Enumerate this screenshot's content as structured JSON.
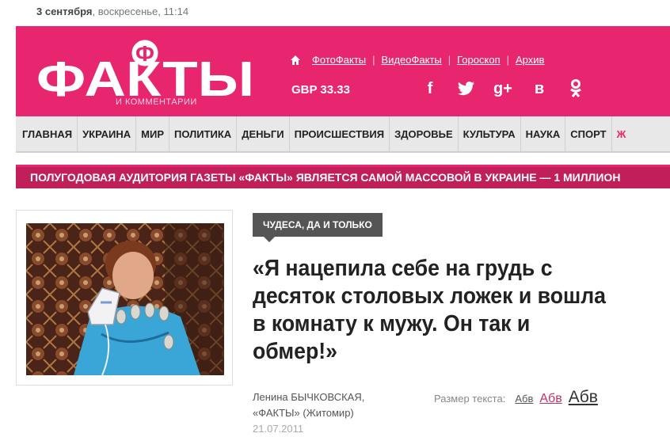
{
  "top": {
    "date_bold": "3 сентября",
    "date_rest": ", воскресенье, 11:14"
  },
  "logo": {
    "title": "ФАКТЫ",
    "letter": "Ф",
    "subtitle": "И КОММЕНТАРИИ"
  },
  "toplinks": [
    "ФотоФакты",
    "ВидеоФакты",
    "Гороскоп",
    "Архив"
  ],
  "currency": "GBP 33.33",
  "social": [
    {
      "icon": "facebook-icon",
      "glyph": "f"
    },
    {
      "icon": "twitter-icon",
      "glyph": "🐦"
    },
    {
      "icon": "google-plus-icon",
      "glyph": "g+"
    },
    {
      "icon": "vkontakte-icon",
      "glyph": "в"
    },
    {
      "icon": "odnoklassniki-icon",
      "glyph": "ок"
    }
  ],
  "nav": [
    "ГЛАВНАЯ",
    "УКРАИНА",
    "МИР",
    "ПОЛИТИКА",
    "ДЕНЬГИ",
    "ПРОИСШЕСТВИЯ",
    "ЗДОРОВЬЕ",
    "КУЛЬТУРА",
    "НАУКА",
    "СПОРТ",
    "Ж"
  ],
  "banner": "ПОЛУГОДОВАЯ АУДИТОРИЯ ГАЗЕТЫ «ФАКТЫ» ЯВЛЯЕТСЯ САМОЙ МАССОВОЙ В УКРАИНЕ — 1 МИЛЛИОН",
  "article": {
    "rubric": "ЧУДЕСА, ДА И ТОЛЬКО",
    "headline": "«Я нацепила себе на грудь с десяток столовых ложек и вошла в комнату к мужу. Он так и обмер!»",
    "author_line1": "Ленина БЫЧКОВСКАЯ,",
    "author_line2": "«ФАКТЫ» (Житомир)",
    "date": "21.07.2011"
  },
  "fontsize": {
    "label": "Размер текста:",
    "small": "Абв",
    "medium": "Абв",
    "large": "Абв"
  },
  "colors": {
    "brand": "#e8266f",
    "banner": "#c01f5a",
    "rubric": "#555555"
  }
}
